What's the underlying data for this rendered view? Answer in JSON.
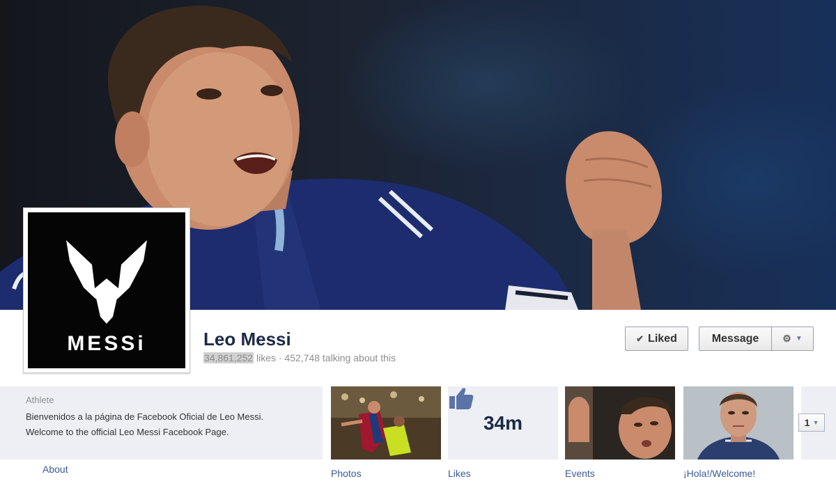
{
  "page": {
    "name": "Leo Messi",
    "likes_count": "34,861,252",
    "likes_suffix": "likes · 452,748 talking about this",
    "category": "Athlete",
    "description_line1": "Bienvenidos a la página de Facebook Oficial de Leo Messi.",
    "description_line2": "Welcome to the official Leo Messi Facebook Page.",
    "about_link": "About"
  },
  "actions": {
    "liked_label": "Liked",
    "message_label": "Message"
  },
  "profile_logo": {
    "text": "MESSi"
  },
  "tiles": [
    {
      "label": "Photos"
    },
    {
      "label": "Likes",
      "count": "34m"
    },
    {
      "label": "Events"
    },
    {
      "label": "¡Hola!/Welcome!"
    }
  ],
  "more_tiles_count": "1",
  "colors": {
    "link_blue": "#3b5998",
    "name_navy": "#1c2a47",
    "strip_gray": "#edeff4"
  },
  "icons": {
    "liked": "check-icon",
    "gear": "gear-icon",
    "dropdown": "chevron-down-icon",
    "likes_tile": "thumbs-up-icon"
  }
}
